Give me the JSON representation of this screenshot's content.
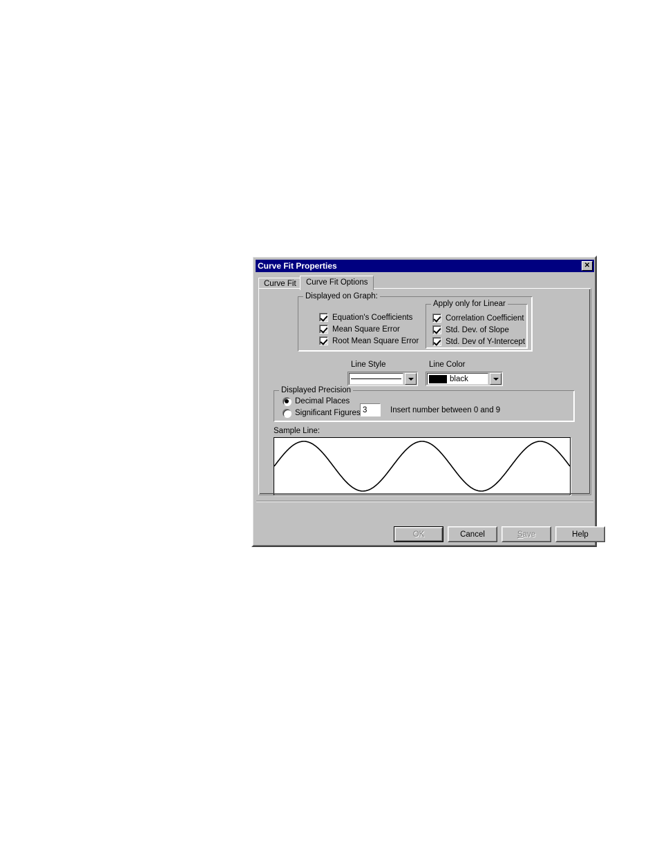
{
  "window": {
    "title": "Curve Fit Properties",
    "close_icon": "close-icon",
    "close_label": "✕"
  },
  "tabs": [
    {
      "label": "Curve Fit",
      "active": false
    },
    {
      "label": "Curve Fit Options",
      "active": true
    }
  ],
  "displayed_on_graph": {
    "title": "Displayed on Graph:",
    "checkboxes": [
      {
        "label": "Equation's Coefficients",
        "checked": true
      },
      {
        "label": "Mean Square Error",
        "checked": true
      },
      {
        "label": "Root Mean Square Error",
        "checked": true
      }
    ]
  },
  "apply_only_for_linear": {
    "title": "Apply only for Linear",
    "checkboxes": [
      {
        "label": "Correlation Coefficient",
        "checked": true
      },
      {
        "label": "Std. Dev. of Slope",
        "checked": true
      },
      {
        "label": "Std. Dev of Y-Intercept",
        "checked": true
      }
    ]
  },
  "line_style": {
    "label": "Line Style",
    "value": "",
    "arrow_icon": "chevron-down-icon"
  },
  "line_color": {
    "label": "Line Color",
    "value": "black",
    "swatch_hex": "#000000",
    "arrow_icon": "chevron-down-icon"
  },
  "displayed_precision": {
    "title": "Displayed Precision",
    "radios": [
      {
        "label": "Decimal Places",
        "selected": true
      },
      {
        "label": "Significant Figures",
        "selected": false
      }
    ],
    "value_field": "3",
    "hint": "Insert number between 0 and 9"
  },
  "sample_line": {
    "label": "Sample Line:",
    "waveform": "sine",
    "cycles": 2.5,
    "stroke_hex": "#000000"
  },
  "buttons": [
    {
      "name": "ok",
      "label": "OK",
      "enabled": false,
      "default": true
    },
    {
      "name": "cancel",
      "label": "Cancel",
      "enabled": true,
      "default": false
    },
    {
      "name": "save",
      "label": "Save",
      "enabled": false,
      "default": false,
      "accel": "S"
    },
    {
      "name": "help",
      "label": "Help",
      "enabled": true,
      "default": false
    }
  ],
  "colors": {
    "titlebar": "#000080",
    "dialog_face": "#c0c0c0",
    "text": "#000000"
  }
}
